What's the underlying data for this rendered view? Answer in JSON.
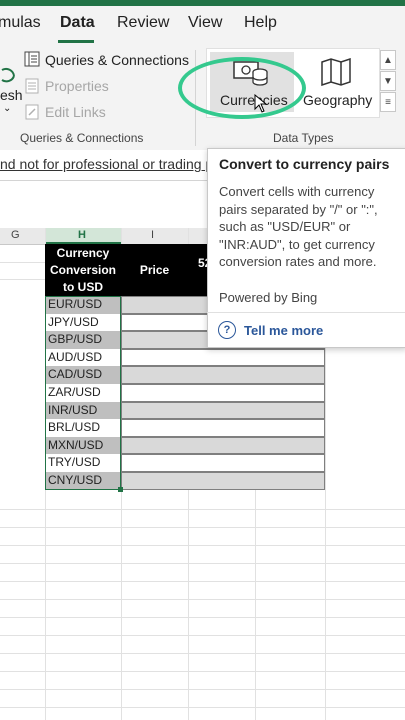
{
  "tabs": [
    {
      "label": "mulas",
      "active": false
    },
    {
      "label": "Data",
      "active": true
    },
    {
      "label": "Review",
      "active": false
    },
    {
      "label": "View",
      "active": false
    },
    {
      "label": "Help",
      "active": false
    }
  ],
  "ribbon": {
    "refresh_label": "esh",
    "queries_connections": "Queries & Connections",
    "properties": "Properties",
    "edit_links": "Edit Links",
    "group_queries_label": "Queries & Connections",
    "currencies": "Currencies",
    "geography": "Geography",
    "group_datatypes_label": "Data Types"
  },
  "banner": {
    "text": "nd not for professional or trading pu"
  },
  "columns": [
    "G",
    "H",
    "I"
  ],
  "sheet": {
    "header_h": "Currency\nConversion\nto USD",
    "header_i": "Price",
    "header_j_partial": "52",
    "pairs": [
      "EUR/USD",
      "JPY/USD",
      "GBP/USD",
      "AUD/USD",
      "CAD/USD",
      "ZAR/USD",
      "INR/USD",
      "BRL/USD",
      "MXN/USD",
      "TRY/USD",
      "CNY/USD"
    ]
  },
  "tooltip": {
    "title": "Convert to currency pairs",
    "body": "Convert cells with currency pairs separated by \"/\" or \":\", such as \"USD/EUR\" or \"INR:AUD\", to get currency conversion rates and more.",
    "powered": "Powered by Bing",
    "tell_me_more": "Tell me more"
  },
  "colors": {
    "accent": "#217346",
    "highlight_ellipse": "#34c98e",
    "link": "#2b579a"
  }
}
